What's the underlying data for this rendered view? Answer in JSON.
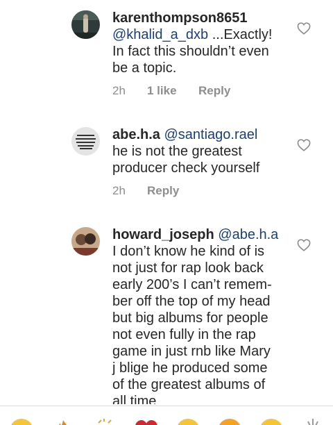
{
  "comments": [
    {
      "username": "karenthompson8651",
      "mention": "@khalid_a_dxb",
      "lines": [
        "...Exactly!",
        "In fact this shouldn’t even",
        "be a topic."
      ],
      "time": "2h",
      "likes": "1 like",
      "reply": "Reply"
    },
    {
      "username": "abe.h.a",
      "mention": "@santiago.rael",
      "lines": [
        "he is not the greatest",
        "producer check yourself"
      ],
      "time": "2h",
      "reply": "Reply"
    },
    {
      "username": "howard_joseph",
      "mention": "@abe.h.a",
      "lines": [
        "I don’t know he kind of is",
        "not just for rap look back",
        "early 200’s I can’t remem-",
        "ber off the top of my head",
        "but big albums for people",
        "not even fully in the rap",
        "game in just rnb like Mary",
        "j blige he produced some",
        "of the greatest albums of",
        "all time"
      ]
    }
  ],
  "icons": {
    "like": "heart-outline-icon",
    "emoji_bar": [
      "grinning-face-icon",
      "fire-icon",
      "clapping-hands-icon",
      "red-heart-icon",
      "smiling-face-icon",
      "heart-eyes-icon",
      "laughing-face-icon",
      "sparkle-icon"
    ]
  },
  "colors": {
    "text": "#262626",
    "mention": "#1a3f7a",
    "meta": "#8e8e8e"
  }
}
